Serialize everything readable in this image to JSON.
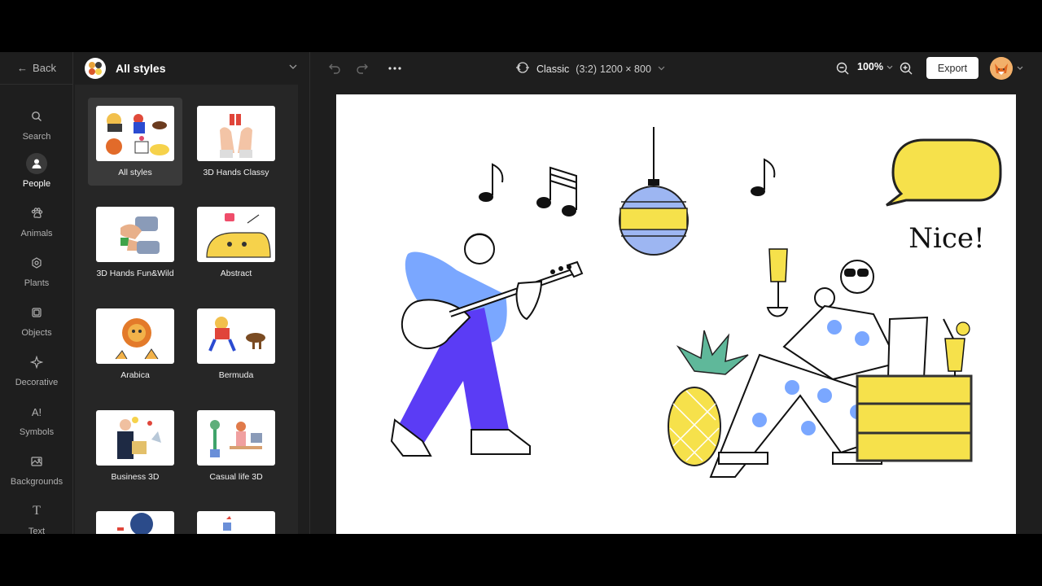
{
  "nav": {
    "back_label": "Back",
    "items": [
      {
        "label": "Search",
        "icon": "search-icon"
      },
      {
        "label": "People",
        "icon": "person-icon",
        "active": true
      },
      {
        "label": "Animals",
        "icon": "paw-icon"
      },
      {
        "label": "Plants",
        "icon": "plant-icon"
      },
      {
        "label": "Objects",
        "icon": "objects-icon"
      },
      {
        "label": "Decorative",
        "icon": "sparkle-icon"
      },
      {
        "label": "Symbols",
        "icon": "symbols-icon"
      },
      {
        "label": "Backgrounds",
        "icon": "image-icon"
      },
      {
        "label": "Text",
        "icon": "text-icon"
      }
    ]
  },
  "panel": {
    "title": "All styles",
    "styles": [
      {
        "label": "All styles",
        "selected": true
      },
      {
        "label": "3D Hands Classy"
      },
      {
        "label": "3D Hands Fun&Wild"
      },
      {
        "label": "Abstract"
      },
      {
        "label": "Arabica"
      },
      {
        "label": "Bermuda"
      },
      {
        "label": "Business 3D"
      },
      {
        "label": "Casual life 3D"
      }
    ]
  },
  "toolbar": {
    "preset_name": "Classic",
    "preset_ratio": "(3:2)",
    "preset_dims": "1200 × 800",
    "zoom": "100%",
    "export_label": "Export"
  },
  "artboard": {
    "speech_bubble": "Nice!"
  },
  "colors": {
    "app_bg": "#1e1e1e",
    "panel_bg": "#262626",
    "accent_blue": "#7aa7ff",
    "accent_purple": "#5b3cf5",
    "accent_yellow": "#f6e14b"
  }
}
